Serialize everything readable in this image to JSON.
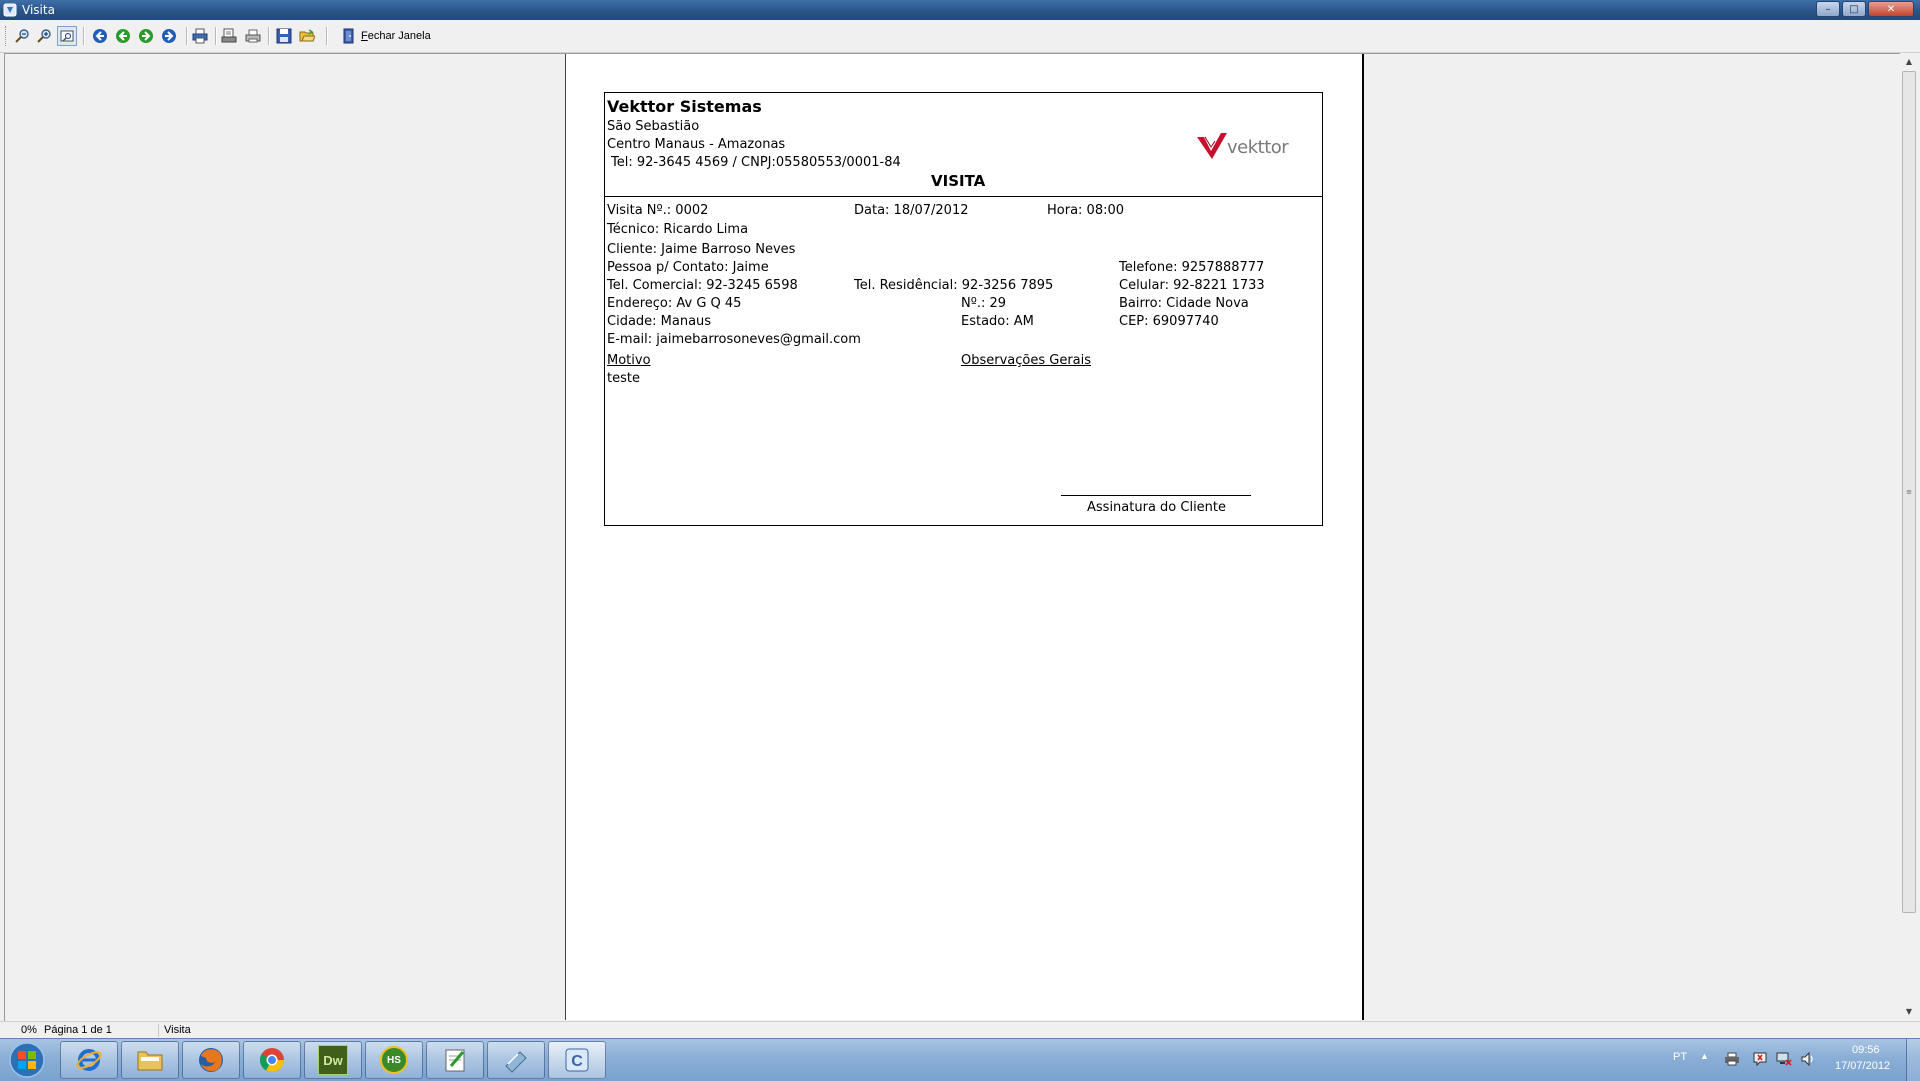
{
  "window": {
    "title": "Visita",
    "controls": {
      "minimize": "–",
      "maximize": "□",
      "close": "✕"
    }
  },
  "toolbar": {
    "buttons": [
      {
        "name": "zoom-out-icon"
      },
      {
        "name": "zoom-in-icon"
      },
      {
        "name": "zoom-fit-icon"
      },
      {
        "name": "first-page-icon"
      },
      {
        "name": "previous-page-icon"
      },
      {
        "name": "next-page-icon"
      },
      {
        "name": "last-page-icon"
      },
      {
        "name": "print-icon"
      },
      {
        "name": "print-setup-icon"
      },
      {
        "name": "printer-icon"
      },
      {
        "name": "save-icon"
      },
      {
        "name": "open-folder-icon"
      }
    ],
    "close_label_prefix": "F",
    "close_label_rest": "echar Janela"
  },
  "report": {
    "company_name": "Vekttor Sistemas",
    "address_line1": "São Sebastião",
    "address_line2": "Centro  Manaus - Amazonas",
    "address_line3": "Tel: 92-3645 4569 / CNPJ:05580553/0001-84",
    "doc_title": "VISITA",
    "logo_text": "vekttor",
    "visit_number": "Visita Nº.: 0002",
    "date": "Data: 18/07/2012",
    "time": "Hora: 08:00",
    "technician": "Técnico: Ricardo Lima",
    "client": "Cliente: Jaime Barroso Neves",
    "contact": "Pessoa p/ Contato: Jaime",
    "phone": "Telefone: 9257888777",
    "commercial_phone": "Tel. Comercial: 92-3245 6598",
    "residential_phone": "Tel. Residêncial: 92-3256 7895",
    "mobile": "Celular: 92-8221 1733",
    "address": "Endereço: Av G Q 45",
    "number": "Nº.: 29",
    "neighborhood": "Bairro: Cidade Nova",
    "city": "Cidade: Manaus",
    "state": "Estado: AM",
    "zip": "CEP:  69097740",
    "email": "E-mail: jaimebarrosoneves@gmail.com",
    "reason_label": "Motivo",
    "reason_value": "teste",
    "notes_label": "Observações Gerais",
    "signature_label": "Assinatura do Cliente"
  },
  "statusbar": {
    "zoom": "0%",
    "page": "Página 1 de 1",
    "title": "Visita"
  },
  "taskbar": {
    "apps": [
      {
        "name": "internet-explorer-icon"
      },
      {
        "name": "file-explorer-icon"
      },
      {
        "name": "firefox-icon"
      },
      {
        "name": "chrome-icon"
      },
      {
        "name": "dreamweaver-icon",
        "label": "Dw"
      },
      {
        "name": "heidisql-icon",
        "label": "HS"
      },
      {
        "name": "notepad-app-icon"
      },
      {
        "name": "database-app-icon"
      },
      {
        "name": "delphi-app-icon"
      }
    ],
    "language": "PT",
    "time": "09:56",
    "date": "17/07/2012"
  },
  "colors": {
    "titlebar": "#2a5488",
    "taskbar": "#8aaed6",
    "logo_red": "#c8102e",
    "logo_gray": "#7a7a7a"
  }
}
